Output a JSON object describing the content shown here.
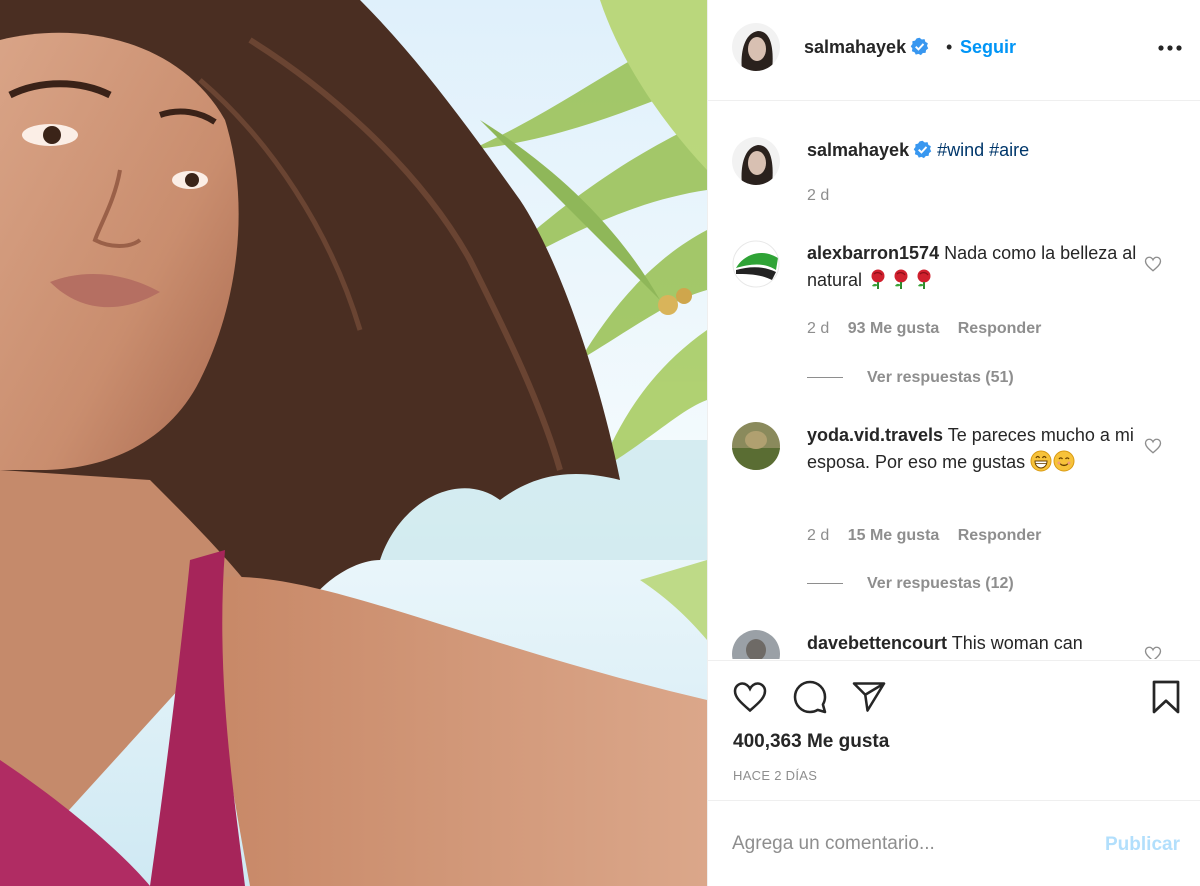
{
  "post": {
    "username": "salmahayek",
    "separator": "•",
    "follow_label": "Seguir",
    "caption_tags": "#wind #aire",
    "caption_time": "2 d",
    "likes_text": "400,363 Me gusta",
    "posted_ago": "HACE 2 DÍAS"
  },
  "comments": [
    {
      "username": "alexbarron1574",
      "text": "Nada como la belleza al natural",
      "emojis": [
        "rose",
        "rose",
        "rose"
      ],
      "time": "2 d",
      "likes": "93 Me gusta",
      "reply_label": "Responder",
      "view_replies": "Ver respuestas (51)"
    },
    {
      "username": "yoda.vid.travels",
      "text": "Te pareces mucho a mi esposa. Por eso me gustas",
      "emojis": [
        "grinning-face",
        "smiling-face"
      ],
      "time": "2 d",
      "likes": "15 Me gusta",
      "reply_label": "Responder",
      "view_replies": "Ver respuestas (12)"
    },
    {
      "username": "davebettencourt",
      "text": "This woman can"
    }
  ],
  "comment_box": {
    "placeholder": "Agrega un comentario...",
    "publish_label": "Publicar"
  },
  "icons": {
    "verified": "verified-badge-icon",
    "more": "more-options-icon",
    "like": "heart-icon",
    "comment": "comment-icon",
    "share": "share-icon",
    "save": "bookmark-icon"
  },
  "colors": {
    "link_blue": "#0095f6",
    "publish_disabled": "#b2dffc",
    "text_secondary": "#8e8e8e",
    "verified_blue": "#3897f0"
  }
}
